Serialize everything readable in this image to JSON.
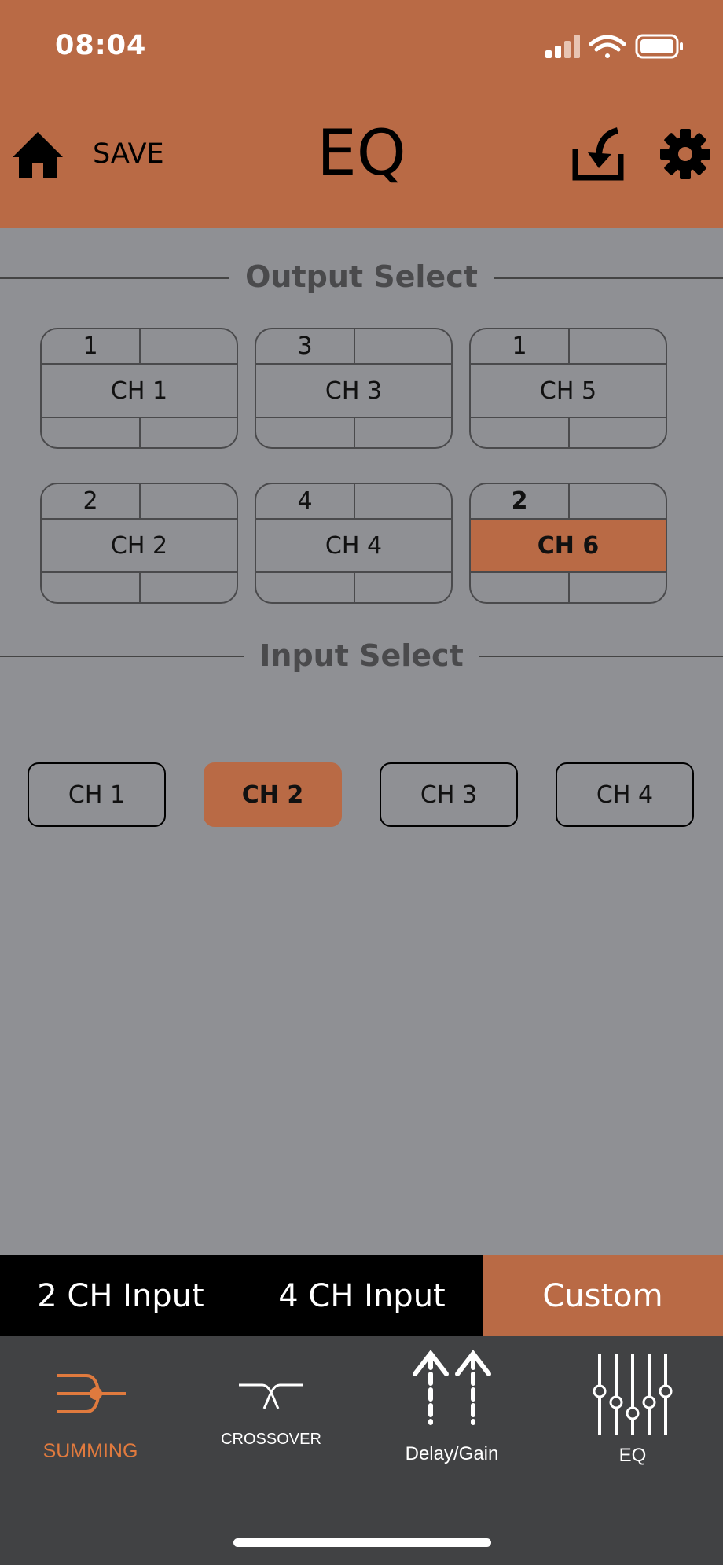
{
  "status_bar": {
    "time": "08:04"
  },
  "header": {
    "save_label": "SAVE",
    "title": "EQ"
  },
  "output_select": {
    "title": "Output Select",
    "channels": [
      {
        "label": "CH 1",
        "input": "1",
        "selected": false
      },
      {
        "label": "CH 3",
        "input": "3",
        "selected": false
      },
      {
        "label": "CH 5",
        "input": "1",
        "selected": false
      },
      {
        "label": "CH 2",
        "input": "2",
        "selected": false
      },
      {
        "label": "CH 4",
        "input": "4",
        "selected": false
      },
      {
        "label": "CH 6",
        "input": "2",
        "selected": true
      }
    ]
  },
  "input_select": {
    "title": "Input Select",
    "channels": [
      {
        "label": "CH 1",
        "selected": false
      },
      {
        "label": "CH 2",
        "selected": true
      },
      {
        "label": "CH 3",
        "selected": false
      },
      {
        "label": "CH 4",
        "selected": false
      }
    ]
  },
  "mode_bar": {
    "options": [
      {
        "label": "2 CH Input",
        "selected": false
      },
      {
        "label": "4 CH Input",
        "selected": false
      },
      {
        "label": "Custom",
        "selected": true
      }
    ]
  },
  "tab_bar": {
    "tabs": [
      {
        "label": "SUMMING",
        "icon": "summing-icon",
        "active": true
      },
      {
        "label": "CROSSOVER",
        "icon": "crossover-icon",
        "active": false
      },
      {
        "label": "Delay/Gain",
        "icon": "delay-gain-icon",
        "active": false
      },
      {
        "label": "EQ",
        "icon": "eq-sliders-icon",
        "active": false
      }
    ]
  },
  "colors": {
    "accent": "#b96a45",
    "background": "#8f9094",
    "tab_bar_bg": "#414244",
    "active_tab": "#e07a3e"
  }
}
